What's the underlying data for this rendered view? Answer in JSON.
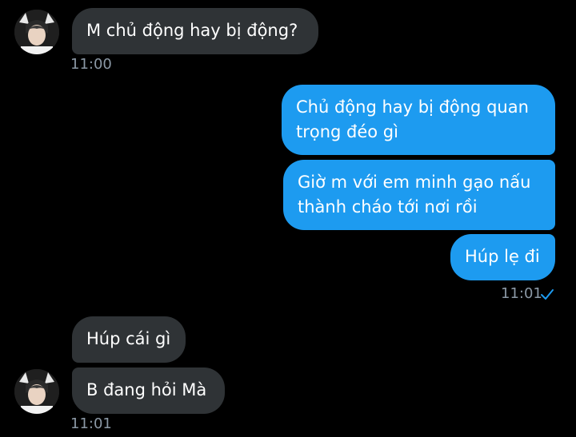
{
  "messages": [
    {
      "id": "m1",
      "direction": "incoming",
      "text": "M chủ động hay bị động?"
    },
    {
      "id": "m2",
      "direction": "outgoing",
      "lines": [
        "Chủ động hay bị động quan",
        "trọng đéo gì"
      ]
    },
    {
      "id": "m3",
      "direction": "outgoing",
      "lines": [
        "Giờ m với em minh gạo nấu",
        "thành cháo tới nơi rồi"
      ]
    },
    {
      "id": "m4",
      "direction": "outgoing",
      "text": "Húp lẹ đi"
    },
    {
      "id": "m5",
      "direction": "incoming",
      "text": "Húp cái gì"
    },
    {
      "id": "m6",
      "direction": "incoming",
      "text": "B đang hỏi Mà"
    }
  ],
  "timestamps": {
    "first_incoming": "11:00",
    "outgoing_group": "11:01",
    "second_incoming": "11:01"
  },
  "colors": {
    "background": "#000000",
    "incoming_bubble": "#2f3336",
    "outgoing_bubble": "#1d9bf0",
    "timestamp": "#8b98a5",
    "read_check": "#1d9bf0"
  },
  "icons": {
    "read_receipt": "checkmark-icon",
    "avatar": "contact-avatar"
  }
}
